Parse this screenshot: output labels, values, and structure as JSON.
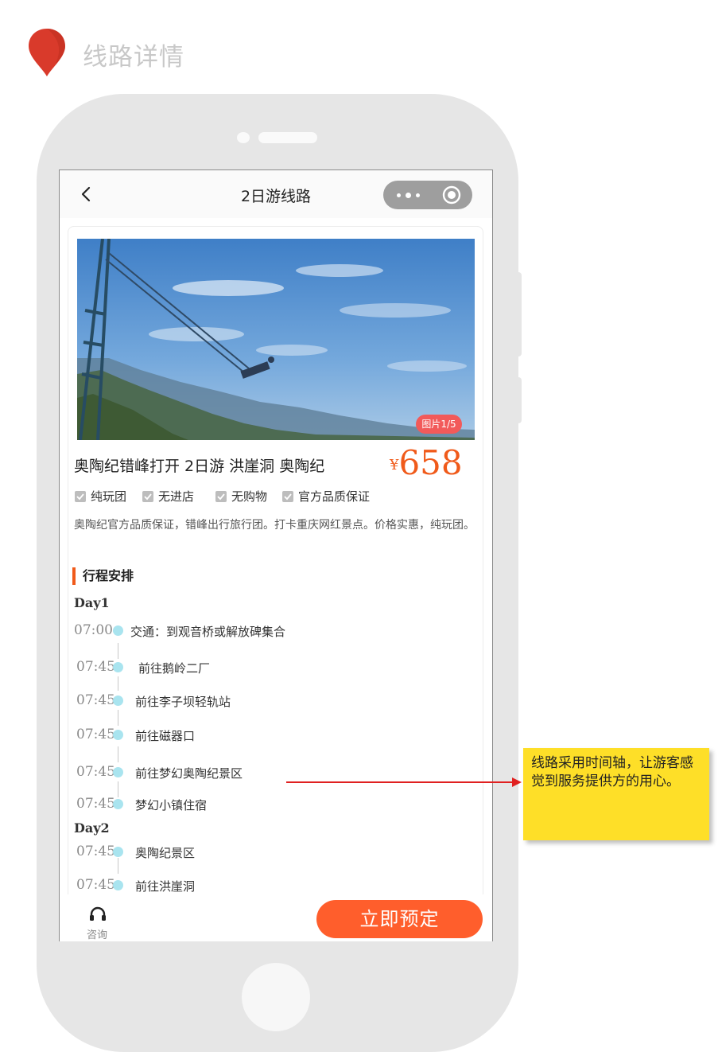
{
  "page_label": "线路详情",
  "nav": {
    "title": "2日游线路"
  },
  "gallery": {
    "badge": "图片1/5"
  },
  "route": {
    "title": "奥陶纪错峰打开  2日游  洪崖洞  奥陶纪",
    "currency": "¥",
    "price": "658",
    "tags": [
      "纯玩团",
      "无进店",
      "无购物",
      "官方品质保证"
    ],
    "description": "奥陶纪官方品质保证，错峰出行旅行团。打卡重庆网红景点。价格实惠，纯玩团。"
  },
  "itinerary": {
    "section_title": "行程安排",
    "days": [
      {
        "label": "Day1",
        "items": [
          {
            "time": "07:00",
            "text": "交通：到观音桥或解放碑集合"
          },
          {
            "time": "07:45",
            "text": "前往鹅岭二厂"
          },
          {
            "time": "07:45",
            "text": "前往李子坝轻轨站"
          },
          {
            "time": "07:45",
            "text": "前往磁器口"
          },
          {
            "time": "07:45",
            "text": "前往梦幻奥陶纪景区"
          },
          {
            "time": "07:45",
            "text": "梦幻小镇住宿"
          }
        ]
      },
      {
        "label": "Day2",
        "items": [
          {
            "time": "07:45",
            "text": "奥陶纪景区"
          },
          {
            "time": "07:45",
            "text": "前往洪崖洞"
          }
        ]
      }
    ]
  },
  "bottom_bar": {
    "consult_label": "咨询",
    "book_label": "立即预定"
  },
  "annotation": {
    "text": "线路采用时间轴，让游客感觉到服务提供方的用心。"
  },
  "colors": {
    "accent": "#f05a1a",
    "book_button": "#ff5e2c",
    "timeline_dot": "#a9e4ef",
    "note_background": "#fedf28",
    "arrow": "#e02020",
    "pin": "#d93a2b"
  },
  "icons": [
    "location-pin-icon",
    "back-arrow-icon",
    "more-dots-icon",
    "target-circle-icon",
    "checkbox-icon",
    "headphones-icon"
  ]
}
